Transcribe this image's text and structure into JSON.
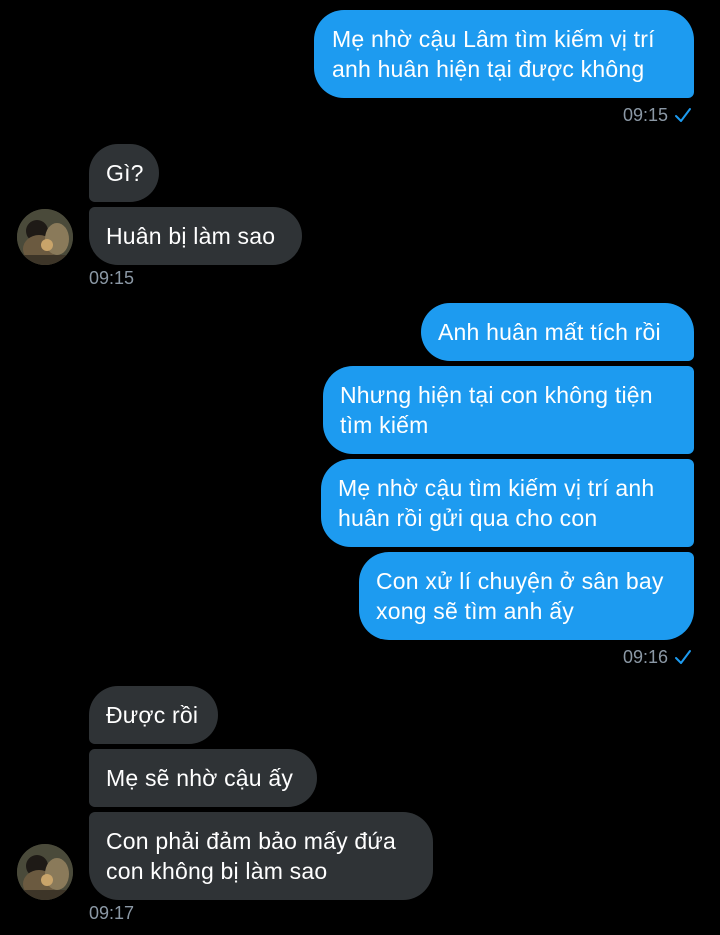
{
  "colors": {
    "background": "#000000",
    "outgoing_bubble": "#1d9bf0",
    "incoming_bubble": "#2f3336",
    "timestamp": "#8b98a5",
    "read_check": "#1d9bf0"
  },
  "messages": {
    "m1": {
      "text": "Mẹ nhờ cậu Lâm tìm kiếm vị trí anh huân hiện tại được không"
    },
    "t1": {
      "time": "09:15",
      "status_icon": "read-check-icon"
    },
    "m2": {
      "text": "Gì?"
    },
    "m3": {
      "text": "Huân bị làm sao"
    },
    "t2": {
      "time": "09:15"
    },
    "m4": {
      "text": "Anh huân mất tích rồi"
    },
    "m5": {
      "text": "Nhưng hiện tại con không tiện tìm kiếm"
    },
    "m6": {
      "text": "Mẹ nhờ cậu tìm kiếm vị trí anh huân rồi gửi qua cho con"
    },
    "m7": {
      "text": "Con xử lí chuyện ở sân bay xong sẽ tìm anh ấy"
    },
    "t3": {
      "time": "09:16",
      "status_icon": "read-check-icon"
    },
    "m8": {
      "text": "Được rồi"
    },
    "m9": {
      "text": "Mẹ sẽ nhờ cậu ấy"
    },
    "m10": {
      "text": "Con phải đảm bảo mấy đứa con không bị làm sao"
    },
    "t4": {
      "time": "09:17"
    }
  }
}
